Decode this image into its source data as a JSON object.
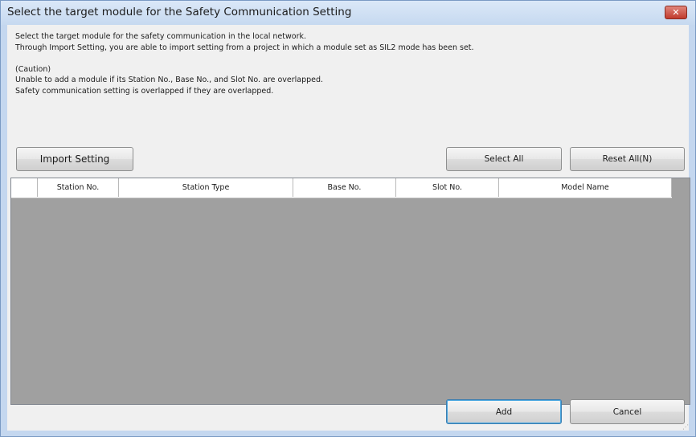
{
  "dialog": {
    "title": "Select the target module for the Safety Communication Setting",
    "close_glyph": "✕"
  },
  "description": {
    "line1": "Select the target module for the safety communication in the local network.",
    "line2": "Through Import Setting, you are able to import setting from a project in which a module set as SIL2 mode has been set.",
    "caution_title": "(Caution)",
    "caution_line1": "Unable to add a module if its Station No., Base No., and Slot No. are overlapped.",
    "caution_line2": "Safety communication setting is overlapped if they are overlapped."
  },
  "toolbar": {
    "import_label": "Import Setting",
    "select_all_label": "Select All",
    "reset_all_label": "Reset All(N)"
  },
  "table": {
    "columns": [
      "",
      "Station No.",
      "Station Type",
      "Base No.",
      "Slot No.",
      "Model Name"
    ],
    "rows": []
  },
  "footer": {
    "add_label": "Add",
    "cancel_label": "Cancel",
    "grip_glyph": "⋰"
  }
}
